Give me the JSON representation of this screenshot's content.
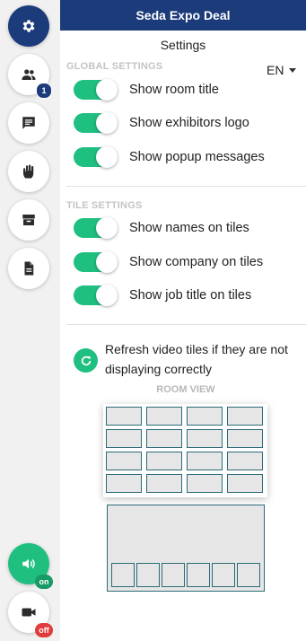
{
  "header": {
    "title": "Seda Expo Deal"
  },
  "panel": {
    "title": "Settings",
    "language": "EN"
  },
  "sidebar": {
    "items": [
      {
        "name": "settings",
        "icon": "gear-icon",
        "active": true
      },
      {
        "name": "participants",
        "icon": "people-icon",
        "badge": "1"
      },
      {
        "name": "chat",
        "icon": "chat-icon"
      },
      {
        "name": "raise-hand",
        "icon": "hand-icon"
      },
      {
        "name": "exhibitors",
        "icon": "inbox-icon"
      },
      {
        "name": "documents",
        "icon": "document-icon"
      }
    ],
    "audio": {
      "icon": "speaker-icon",
      "state": "on"
    },
    "video": {
      "icon": "camera-icon",
      "state": "off"
    }
  },
  "global_settings": {
    "heading": "GLOBAL SETTINGS",
    "items": [
      {
        "label": "Show room title",
        "enabled": true
      },
      {
        "label": "Show exhibitors logo",
        "enabled": true
      },
      {
        "label": "Show popup messages",
        "enabled": true
      }
    ]
  },
  "tile_settings": {
    "heading": "TILE SETTINGS",
    "items": [
      {
        "label": "Show names on tiles",
        "enabled": true
      },
      {
        "label": "Show company on tiles",
        "enabled": true
      },
      {
        "label": "Show job title on tiles",
        "enabled": true
      }
    ]
  },
  "refresh": {
    "text": "Refresh video tiles if they are not displaying correctly"
  },
  "room_view": {
    "label": "ROOM VIEW",
    "grid": {
      "rows": 4,
      "cols": 4
    },
    "speaker": {
      "thumbnails": 6
    }
  },
  "colors": {
    "primary": "#1c3b7a",
    "accent": "#1fbf80",
    "off": "#e23b3b"
  }
}
